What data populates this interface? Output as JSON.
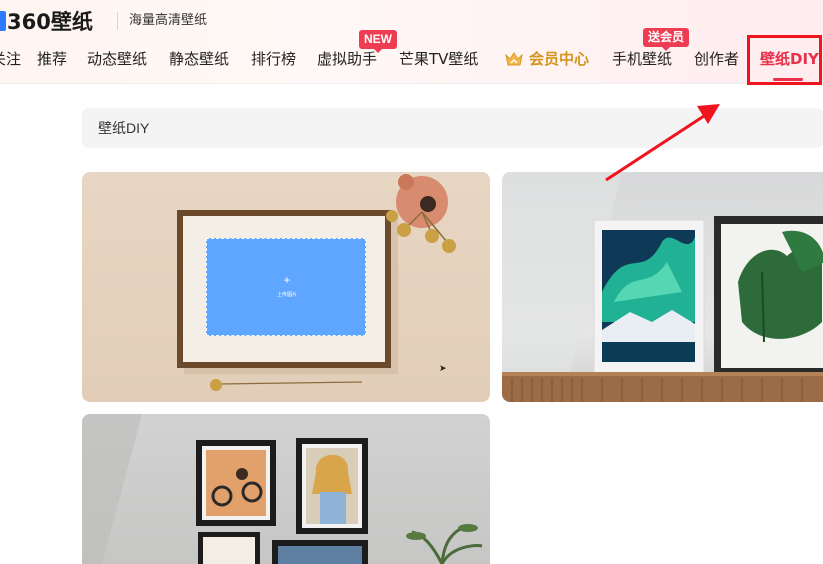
{
  "header": {
    "logo_text": "360壁纸",
    "slogan": "海量高清壁纸",
    "nav": [
      {
        "label": "关注"
      },
      {
        "label": "推荐"
      },
      {
        "label": "动态壁纸"
      },
      {
        "label": "静态壁纸"
      },
      {
        "label": "排行榜"
      },
      {
        "label": "虚拟助手",
        "badge": "NEW"
      },
      {
        "label": "芒果TV壁纸"
      },
      {
        "label": "会员中心",
        "icon": "crown-icon"
      },
      {
        "label": "手机壁纸",
        "badge": "送会员"
      },
      {
        "label": "创作者"
      },
      {
        "label": "壁纸DIY",
        "active": true
      }
    ]
  },
  "path_bar": {
    "text": "壁纸DIY"
  },
  "cards": [
    {
      "name": "photo-frame-on-beige-wall",
      "upload_plus": "+",
      "upload_text": "上传图片"
    },
    {
      "name": "aurora-and-monstera-frames"
    },
    {
      "name": "gallery-wall-frames"
    }
  ],
  "colors": {
    "accent": "#e8304a",
    "gold": "#d4951f",
    "upload_blue": "#5ea6ff",
    "annotation_red": "#f0141e"
  }
}
